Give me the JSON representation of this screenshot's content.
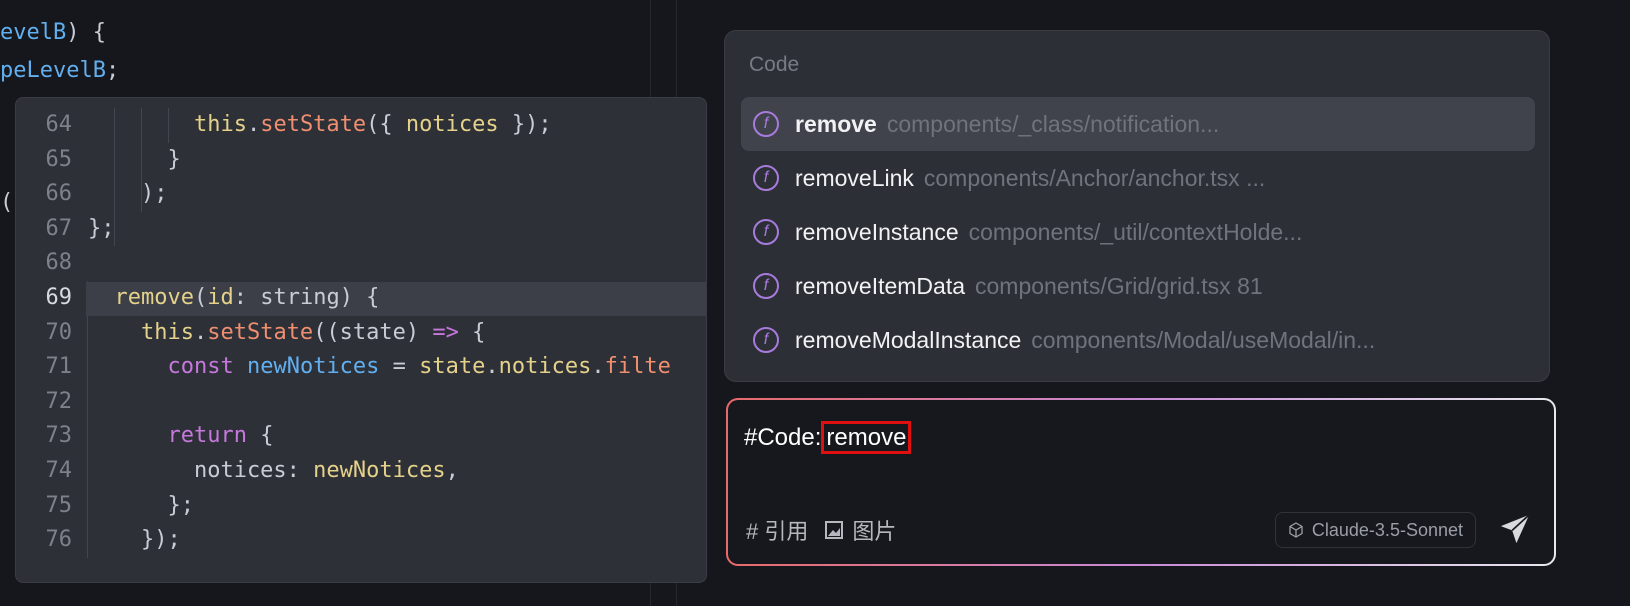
{
  "background_code": [
    {
      "tokens": [
        {
          "t": "evelB",
          "c": "t-b"
        },
        {
          "t": ") {",
          "c": "t-p"
        }
      ]
    },
    {
      "tokens": [
        {
          "t": "peLevelB",
          "c": "t-b"
        },
        {
          "t": ";",
          "c": "t-p"
        }
      ]
    },
    {
      "tokens": [
        {
          "t": "(",
          "c": "t-p"
        }
      ]
    }
  ],
  "peek": {
    "current_line": "69",
    "lines": [
      {
        "n": "64",
        "tokens": [
          {
            "t": "        ",
            "c": "t-p"
          },
          {
            "t": "this",
            "c": "t-y"
          },
          {
            "t": ".",
            "c": "t-p"
          },
          {
            "t": "setState",
            "c": "t-s"
          },
          {
            "t": "({ ",
            "c": "t-p"
          },
          {
            "t": "notices",
            "c": "t-y"
          },
          {
            "t": " });",
            "c": "t-p"
          }
        ]
      },
      {
        "n": "65",
        "tokens": [
          {
            "t": "      }",
            "c": "t-p"
          }
        ]
      },
      {
        "n": "66",
        "tokens": [
          {
            "t": "    );",
            "c": "t-p"
          }
        ]
      },
      {
        "n": "67",
        "tokens": [
          {
            "t": "};",
            "c": "t-p"
          }
        ]
      },
      {
        "n": "68",
        "tokens": []
      },
      {
        "n": "69",
        "tokens": [
          {
            "t": "  ",
            "c": "t-p"
          },
          {
            "t": "remove",
            "c": "t-y"
          },
          {
            "t": "(",
            "c": "t-p"
          },
          {
            "t": "id",
            "c": "t-y"
          },
          {
            "t": ": string) {",
            "c": "t-p"
          }
        ]
      },
      {
        "n": "70",
        "tokens": [
          {
            "t": "    ",
            "c": "t-p"
          },
          {
            "t": "this",
            "c": "t-y"
          },
          {
            "t": ".",
            "c": "t-p"
          },
          {
            "t": "setState",
            "c": "t-s"
          },
          {
            "t": "((state) ",
            "c": "t-p"
          },
          {
            "t": "=>",
            "c": "t-k"
          },
          {
            "t": " {",
            "c": "t-p"
          }
        ]
      },
      {
        "n": "71",
        "tokens": [
          {
            "t": "      ",
            "c": "t-p"
          },
          {
            "t": "const",
            "c": "t-k"
          },
          {
            "t": " ",
            "c": "t-p"
          },
          {
            "t": "newNotices",
            "c": "t-b"
          },
          {
            "t": " = ",
            "c": "t-p"
          },
          {
            "t": "state",
            "c": "t-y"
          },
          {
            "t": ".",
            "c": "t-p"
          },
          {
            "t": "notices",
            "c": "t-y"
          },
          {
            "t": ".",
            "c": "t-p"
          },
          {
            "t": "filte",
            "c": "t-s"
          }
        ]
      },
      {
        "n": "72",
        "tokens": []
      },
      {
        "n": "73",
        "tokens": [
          {
            "t": "      ",
            "c": "t-p"
          },
          {
            "t": "return",
            "c": "t-k"
          },
          {
            "t": " {",
            "c": "t-p"
          }
        ]
      },
      {
        "n": "74",
        "tokens": [
          {
            "t": "        notices: ",
            "c": "t-p"
          },
          {
            "t": "newNotices",
            "c": "t-y"
          },
          {
            "t": ",",
            "c": "t-p"
          }
        ]
      },
      {
        "n": "75",
        "tokens": [
          {
            "t": "      };",
            "c": "t-p"
          }
        ]
      },
      {
        "n": "76",
        "tokens": [
          {
            "t": "    });",
            "c": "t-p"
          }
        ]
      }
    ]
  },
  "dropdown": {
    "title": "Code",
    "selected_index": 0,
    "items": [
      {
        "icon": "function-icon",
        "glyph": "f",
        "name": "remove",
        "path": "components/_class/notification..."
      },
      {
        "icon": "function-icon",
        "glyph": "f",
        "name": "removeLink",
        "path": "components/Anchor/anchor.tsx ..."
      },
      {
        "icon": "function-icon",
        "glyph": "f",
        "name": "removeInstance",
        "path": "components/_util/contextHolde..."
      },
      {
        "icon": "function-icon",
        "glyph": "f",
        "name": "removeItemData",
        "path": "components/Grid/grid.tsx 81"
      },
      {
        "icon": "function-icon",
        "glyph": "f",
        "name": "removeModalInstance",
        "path": "components/Modal/useModal/in..."
      }
    ]
  },
  "input": {
    "prefix": "#Code:",
    "token": "remove",
    "reference_label": "# 引用",
    "image_label": "图片",
    "model": "Claude-3.5-Sonnet"
  },
  "colors": {
    "accent": "#a77bdc",
    "highlight_box": "#e01010"
  }
}
